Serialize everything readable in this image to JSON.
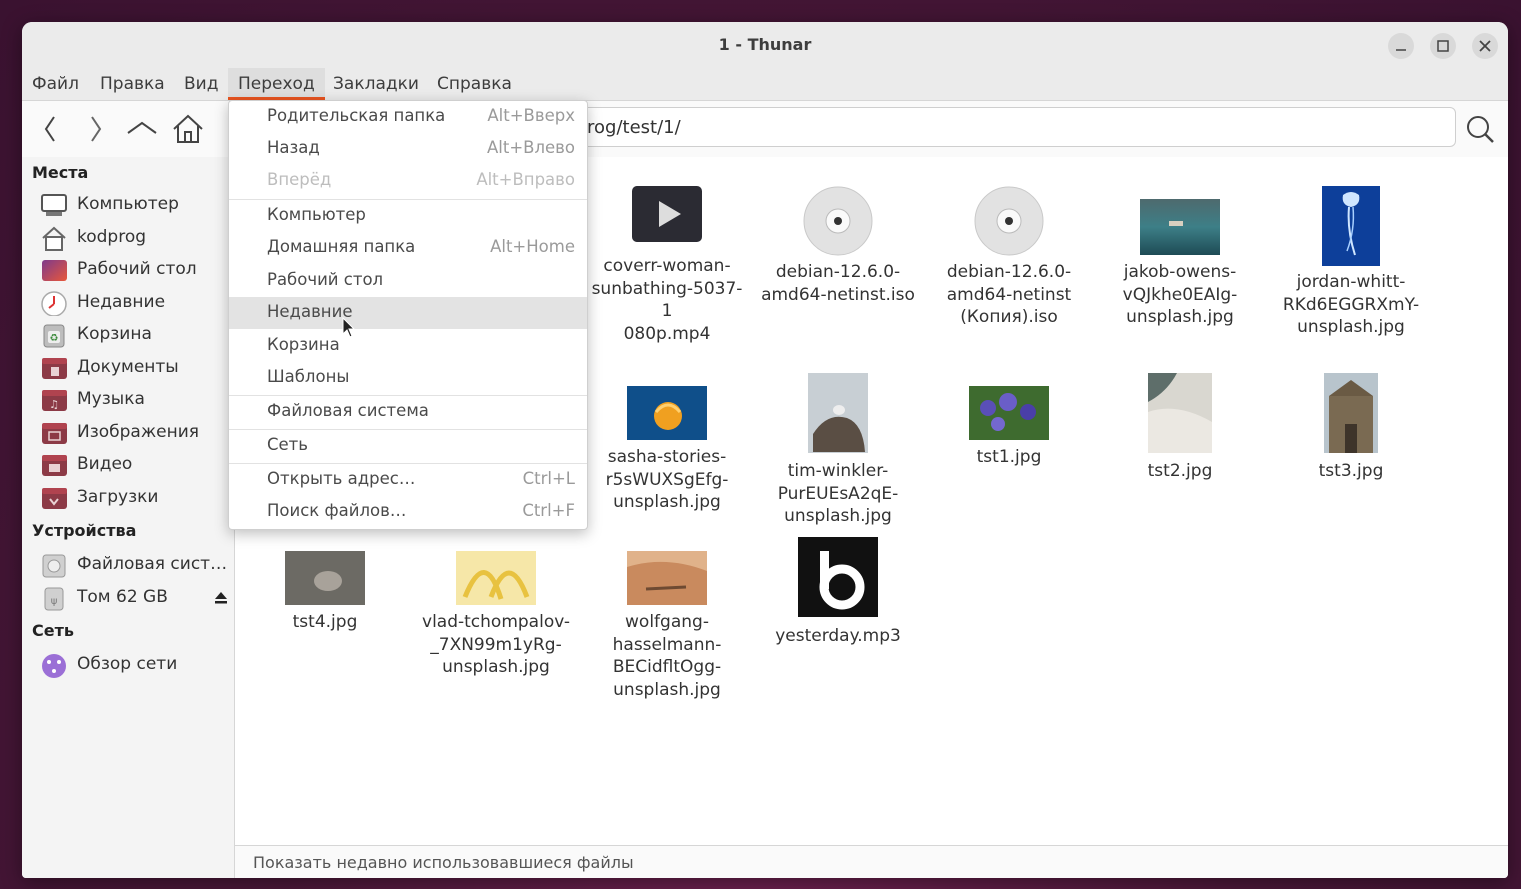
{
  "window": {
    "title": "1 - Thunar"
  },
  "menubar": [
    {
      "label": "Файл"
    },
    {
      "label": "Правка"
    },
    {
      "label": "Вид"
    },
    {
      "label": "Переход"
    },
    {
      "label": "Закладки"
    },
    {
      "label": "Справка"
    }
  ],
  "toolbar": {
    "path_visible": "rog/test/1/"
  },
  "sidebar": {
    "places_header": "Места",
    "places": [
      {
        "label": "Компьютер",
        "icon": "computer-icon"
      },
      {
        "label": "kodprog",
        "icon": "home-folder-icon"
      },
      {
        "label": "Рабочий стол",
        "icon": "desktop-folder-icon"
      },
      {
        "label": "Недавние",
        "icon": "recent-clock-icon"
      },
      {
        "label": "Корзина",
        "icon": "trash-icon"
      },
      {
        "label": "Документы",
        "icon": "documents-folder-icon"
      },
      {
        "label": "Музыка",
        "icon": "music-folder-icon"
      },
      {
        "label": "Изображения",
        "icon": "pictures-folder-icon"
      },
      {
        "label": "Видео",
        "icon": "videos-folder-icon"
      },
      {
        "label": "Загрузки",
        "icon": "downloads-folder-icon"
      }
    ],
    "devices_header": "Устройства",
    "devices": [
      {
        "label": "Файловая сист…",
        "icon": "drive-icon"
      },
      {
        "label": "Том 62 GB",
        "icon": "usb-drive-icon"
      }
    ],
    "network_header": "Сеть",
    "network": [
      {
        "label": "Обзор сети",
        "icon": "network-icon"
      }
    ]
  },
  "files": [
    {
      "line1": "coverr-woman-",
      "line2": "sunbathing-5037-1",
      "line3": "080p.mp4",
      "line4": ""
    },
    {
      "line1": "debian-12.6.0-",
      "line2": "amd64-netinst.iso",
      "line3": "",
      "line4": ""
    },
    {
      "line1": "debian-12.6.0-",
      "line2": "amd64-netinst",
      "line3": "(Копия).iso",
      "line4": ""
    },
    {
      "line1": "jakob-owens-",
      "line2": "vQJkhe0EAIg-",
      "line3": "unsplash.jpg",
      "line4": ""
    },
    {
      "line1": "jordan-whitt-",
      "line2": "RKd6EGGRXmY-",
      "line3": "unsplash.jpg",
      "line4": ""
    },
    {
      "line1": "sasha-stories-",
      "line2": "r5sWUXSgEfg-",
      "line3": "unsplash.jpg",
      "line4": ""
    },
    {
      "line1": "tim-winkler-",
      "line2": "PurEUEsA2qE-",
      "line3": "unsplash.jpg",
      "line4": ""
    },
    {
      "line1": "tst1.jpg",
      "line2": "",
      "line3": "",
      "line4": ""
    },
    {
      "line1": "tst2.jpg",
      "line2": "",
      "line3": "",
      "line4": ""
    },
    {
      "line1": "tst3.jpg",
      "line2": "",
      "line3": "",
      "line4": ""
    },
    {
      "line1": "tst4.jpg",
      "line2": "",
      "line3": "",
      "line4": ""
    },
    {
      "line1": "vlad-tchompalov-",
      "line2": "_7XN99m1yRg-",
      "line3": "unsplash.jpg",
      "line4": ""
    },
    {
      "line1": "wolfgang-",
      "line2": "hasselmann-",
      "line3": "BECidfltOgg-",
      "line4": "unsplash.jpg"
    },
    {
      "line1": "yesterday.mp3",
      "line2": "",
      "line3": "",
      "line4": ""
    }
  ],
  "go_menu": [
    {
      "label": "Родительская папка",
      "accel": "Alt+Вверх"
    },
    {
      "label": "Назад",
      "accel": "Alt+Влево"
    },
    {
      "label": "Вперёд",
      "accel": "Alt+Вправо"
    },
    {
      "label": "Компьютер",
      "accel": ""
    },
    {
      "label": "Домашняя папка",
      "accel": "Alt+Home"
    },
    {
      "label": "Рабочий стол",
      "accel": ""
    },
    {
      "label": "Недавние",
      "accel": ""
    },
    {
      "label": "Корзина",
      "accel": ""
    },
    {
      "label": "Шаблоны",
      "accel": ""
    },
    {
      "label": "Файловая система",
      "accel": ""
    },
    {
      "label": "Сеть",
      "accel": ""
    },
    {
      "label": "Открыть адрес…",
      "accel": "Ctrl+L"
    },
    {
      "label": "Поиск файлов…",
      "accel": "Ctrl+F"
    }
  ],
  "statusbar": {
    "text": "Показать недавно использовавшиеся файлы"
  },
  "colors": {
    "accent": "#e95420",
    "menu_highlight": "#e3e3e3"
  }
}
